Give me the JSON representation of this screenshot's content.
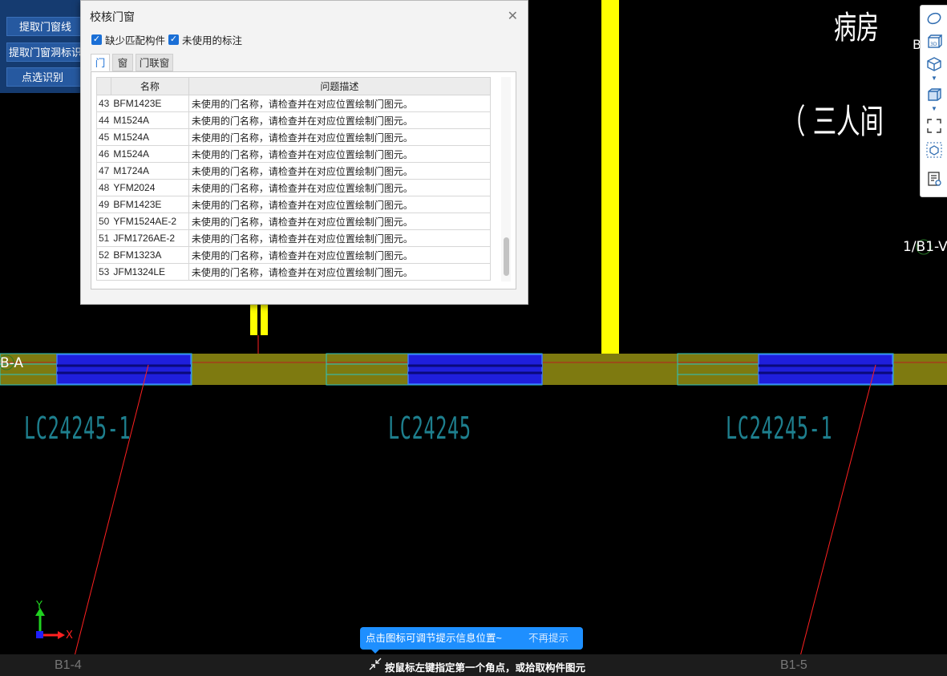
{
  "toolbar": {
    "buttons": [
      "提取门窗线",
      "提取门窗洞标识",
      "点选识别"
    ]
  },
  "dialog": {
    "title": "校核门窗",
    "close_icon": "close-icon",
    "checkbox_missing": "缺少匹配构件",
    "checkbox_unused": "未使用的标注",
    "tabs": [
      "门",
      "窗",
      "门联窗"
    ],
    "table": {
      "headers": [
        "名称",
        "问题描述"
      ],
      "rows": [
        {
          "n": "43",
          "name": "BFM1423E",
          "desc": "未使用的门名称，请检查并在对应位置绘制门图元。"
        },
        {
          "n": "44",
          "name": "M1524A",
          "desc": "未使用的门名称，请检查并在对应位置绘制门图元。"
        },
        {
          "n": "45",
          "name": "M1524A",
          "desc": "未使用的门名称，请检查并在对应位置绘制门图元。"
        },
        {
          "n": "46",
          "name": "M1524A",
          "desc": "未使用的门名称，请检查并在对应位置绘制门图元。"
        },
        {
          "n": "47",
          "name": "M1724A",
          "desc": "未使用的门名称，请检查并在对应位置绘制门图元。"
        },
        {
          "n": "48",
          "name": "YFM2024",
          "desc": "未使用的门名称，请检查并在对应位置绘制门图元。"
        },
        {
          "n": "49",
          "name": "BFM1423E",
          "desc": "未使用的门名称，请检查并在对应位置绘制门图元。"
        },
        {
          "n": "50",
          "name": "YFM1524AE-2",
          "desc": "未使用的门名称，请检查并在对应位置绘制门图元。"
        },
        {
          "n": "51",
          "name": "JFM1726AE-2",
          "desc": "未使用的门名称，请检查并在对应位置绘制门图元。"
        },
        {
          "n": "52",
          "name": "BFM1323A",
          "desc": "未使用的门名称，请检查并在对应位置绘制门图元。"
        },
        {
          "n": "53",
          "name": "JFM1324LE",
          "desc": "未使用的门名称，请检查并在对应位置绘制门图元。"
        }
      ]
    }
  },
  "canvas": {
    "room_label_1": "病房",
    "room_label_2": "（ 三人间",
    "axis_b": "B",
    "axis_ref": "1/B1-V",
    "axis_ba": "B-A",
    "window_labels": [
      "LC24245-1",
      "LC24245",
      "LC24245-1"
    ],
    "axis_b14": "B1-4",
    "axis_b15": "B1-5",
    "ucs_y": "Y",
    "ucs_x": "X"
  },
  "right_toolbar": {
    "icons": [
      "sphere-icon",
      "3d-icon",
      "cube-view-icon",
      "box-icon",
      "fullscreen-icon",
      "select-box-icon",
      "list-settings-icon"
    ]
  },
  "tooltip": {
    "text": "点击图标可调节提示信息位置~",
    "dismiss": "不再提示"
  },
  "status": {
    "text": "按鼠标左键指定第一个角点，或拾取构件图元"
  },
  "colors": {
    "wall": "#7e7a10",
    "window_fill": "#1f1fdc",
    "window_outline": "#29c4c4",
    "column": "#ffff00",
    "line_red": "#ff2020",
    "label_cyan": "#1e7f8e",
    "tooltip_bg": "#1e8fff"
  }
}
